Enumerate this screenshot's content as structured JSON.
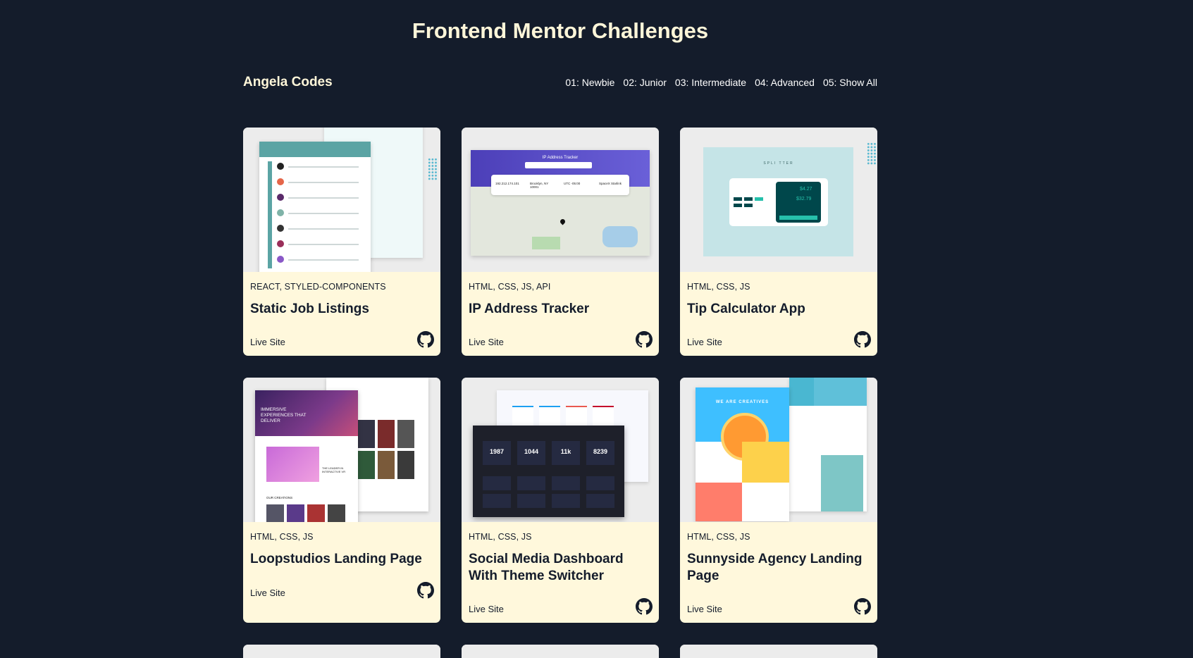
{
  "header": {
    "title": "Frontend Mentor Challenges",
    "brand": "Angela Codes"
  },
  "nav": [
    {
      "label": "01: Newbie"
    },
    {
      "label": "02: Junior"
    },
    {
      "label": "03: Intermediate"
    },
    {
      "label": "04: Advanced"
    },
    {
      "label": "05: Show All"
    }
  ],
  "cards": [
    {
      "tech": "REACT, STYLED-COMPONENTS",
      "title": "Static Job Listings",
      "live": "Live Site",
      "icon": "github-icon"
    },
    {
      "tech": "HTML, CSS, JS, API",
      "title": "IP Address Tracker",
      "live": "Live Site",
      "icon": "github-icon",
      "preview": {
        "heading": "IP Address Tracker",
        "ip": "192.212.174.101",
        "location": "Brooklyn, NY 10001",
        "timezone": "UTC -05:00",
        "isp": "SpaceX Starlink"
      }
    },
    {
      "tech": "HTML, CSS, JS",
      "title": "Tip Calculator App",
      "live": "Live Site",
      "icon": "github-icon",
      "preview": {
        "logo": "SPLI TTER",
        "tip": "$4.27",
        "total": "$32.79"
      }
    },
    {
      "tech": "HTML, CSS, JS",
      "title": "Loopstudios Landing Page",
      "live": "Live Site",
      "icon": "github-icon",
      "preview": {
        "hero": "IMMERSIVE EXPERIENCES THAT DELIVER",
        "creations": "OUR CREATIONS",
        "leader": "THE LEADER IN INTERACTIVE VR"
      }
    },
    {
      "tech": "HTML, CSS, JS",
      "title": "Social Media Dashboard With Theme Switcher",
      "live": "Live Site",
      "icon": "github-icon",
      "preview": {
        "stats": [
          "1987",
          "1044",
          "11k",
          "8239"
        ]
      }
    },
    {
      "tech": "HTML, CSS, JS",
      "title": "Sunnyside Agency Landing Page",
      "live": "Live Site",
      "icon": "github-icon",
      "preview": {
        "hero": "WE ARE CREATIVES"
      }
    }
  ],
  "colors": {
    "background": "#141c2b",
    "card": "#fff8dc",
    "title": "#fff6d9"
  }
}
